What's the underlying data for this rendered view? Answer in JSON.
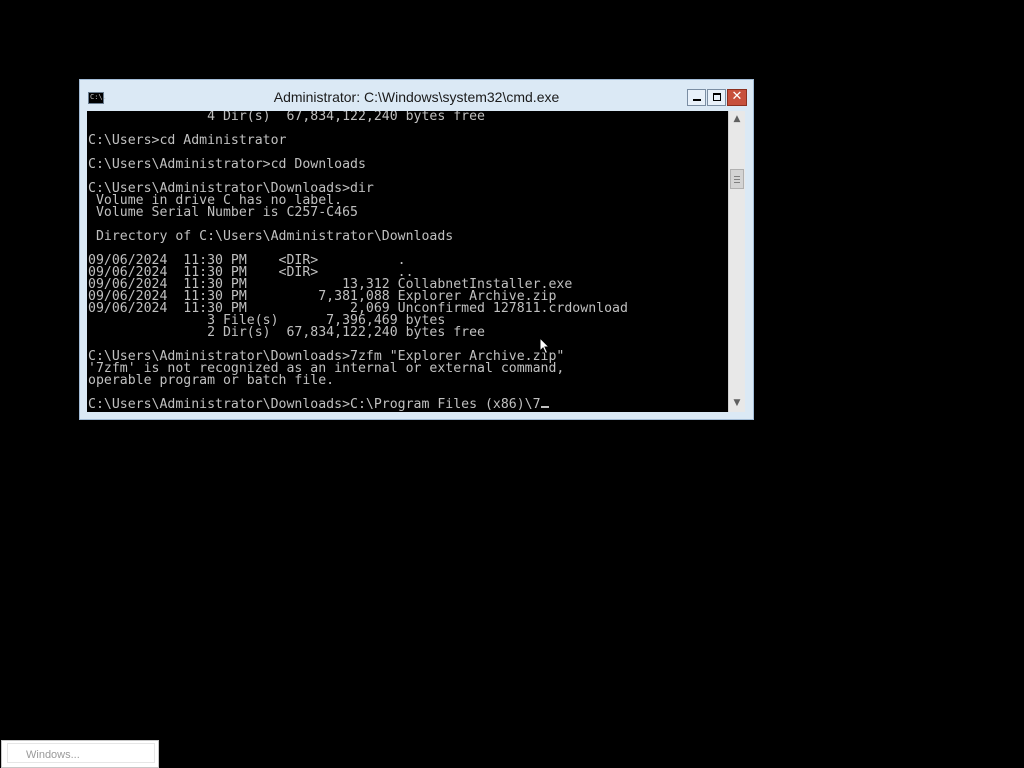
{
  "window": {
    "title": "Administrator: C:\\Windows\\system32\\cmd.exe",
    "icon_text": "C:\\.",
    "close_glyph": "✕",
    "accent_close": "#c7503c"
  },
  "console": {
    "lines": [
      "               4 Dir(s)  67,834,122,240 bytes free",
      "",
      "C:\\Users>cd Administrator",
      "",
      "C:\\Users\\Administrator>cd Downloads",
      "",
      "C:\\Users\\Administrator\\Downloads>dir",
      " Volume in drive C has no label.",
      " Volume Serial Number is C257-C465",
      "",
      " Directory of C:\\Users\\Administrator\\Downloads",
      "",
      "09/06/2024  11:30 PM    <DIR>          .",
      "09/06/2024  11:30 PM    <DIR>          ..",
      "09/06/2024  11:30 PM            13,312 CollabnetInstaller.exe",
      "09/06/2024  11:30 PM         7,381,088 Explorer Archive.zip",
      "09/06/2024  11:30 PM             2,069 Unconfirmed 127811.crdownload",
      "               3 File(s)      7,396,469 bytes",
      "               2 Dir(s)  67,834,122,240 bytes free",
      "",
      "C:\\Users\\Administrator\\Downloads>7zfm \"Explorer Archive.zip\"",
      "'7zfm' is not recognized as an internal or external command,",
      "operable program or batch file.",
      "",
      "C:\\Users\\Administrator\\Downloads>C:\\Program Files (x86)\\7"
    ],
    "text_color": "#c0c0c0",
    "background": "#000000"
  },
  "scrollbar": {
    "up_glyph": "▲",
    "down_glyph": "▼"
  },
  "minimized": {
    "label": "Windows..."
  },
  "icons": {
    "app": "cmd-icon",
    "minimize": "minimize-icon",
    "maximize": "maximize-icon",
    "close": "close-icon",
    "pointer": "mouse-pointer-icon"
  }
}
